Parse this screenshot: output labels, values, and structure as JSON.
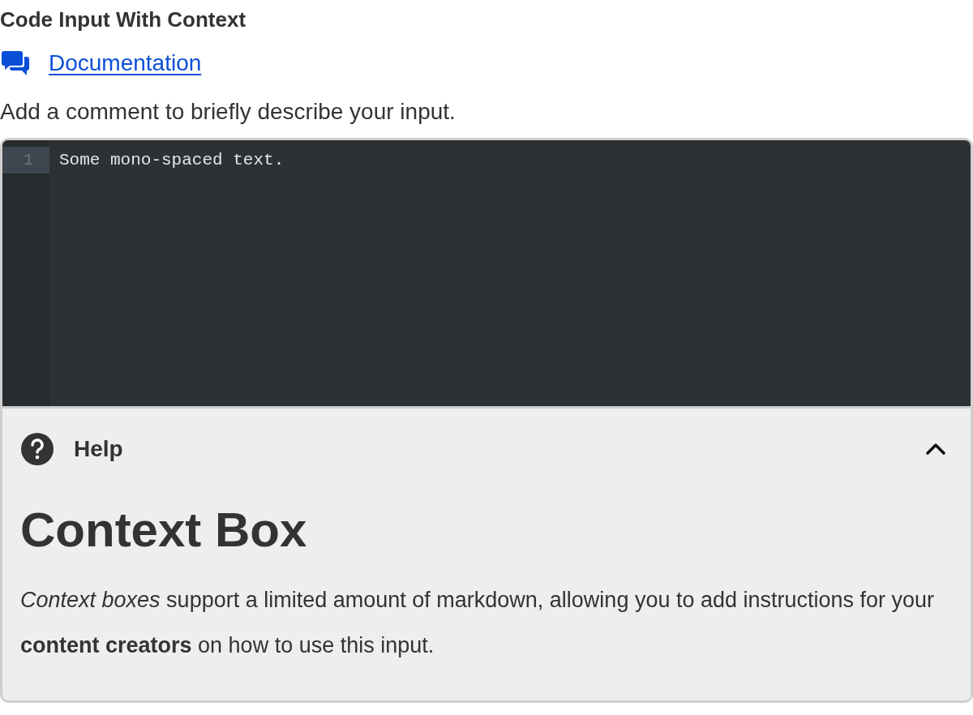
{
  "title": "Code Input With Context",
  "documentation_link": "Documentation",
  "description": "Add a comment to briefly describe your input.",
  "editor": {
    "lines": [
      {
        "number": "1",
        "text": "Some mono-spaced text.",
        "selected": true
      }
    ]
  },
  "help": {
    "label": "Help",
    "expanded": true,
    "heading": "Context Box",
    "body": "*Context boxes* support a limited amount of markdown, allowing you to add instructions for your **content creators** on how to use this input."
  }
}
